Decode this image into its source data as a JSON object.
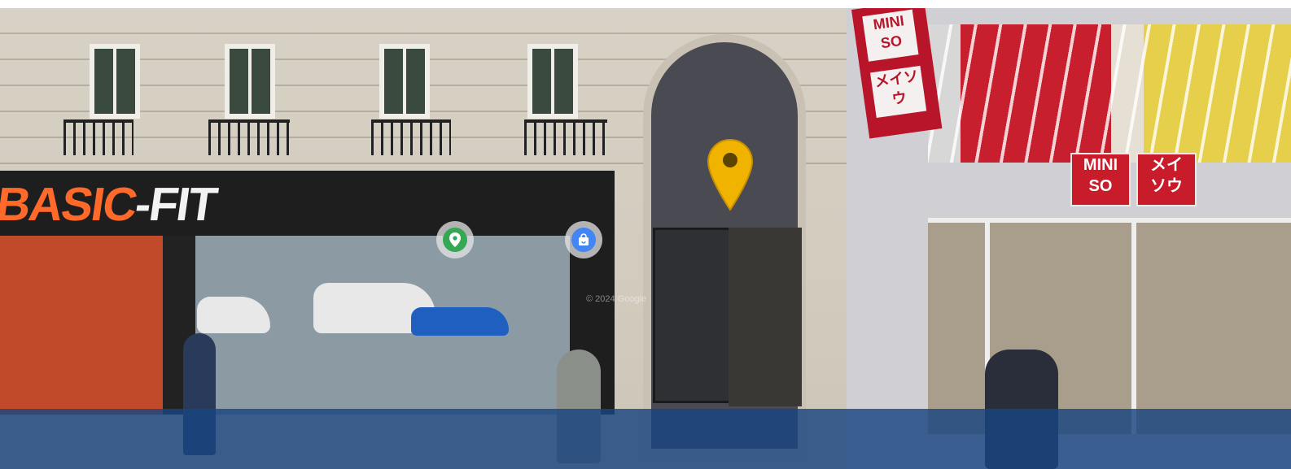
{
  "panorama": {
    "gym_logo_left": "BASIC",
    "gym_logo_right": "-FIT",
    "watermark": "© 2024 Google",
    "shop_sign_left_top": "MINI",
    "shop_sign_left_bottom": "SO",
    "shop_sign_right_top": "メイ",
    "shop_sign_right_bottom": "ソウ",
    "banner_top": "MINI SO",
    "banner_bottom": "メイソウ"
  },
  "markers": {
    "place_pin_icon": "map-pin",
    "place_pin_color": "#f0b400",
    "poi_location": {
      "icon": "location-pin-icon",
      "color": "#34a853"
    },
    "poi_shopping": {
      "icon": "shopping-bag-icon",
      "color": "#4285f4"
    }
  },
  "colors": {
    "bottom_bar": "#184480"
  }
}
